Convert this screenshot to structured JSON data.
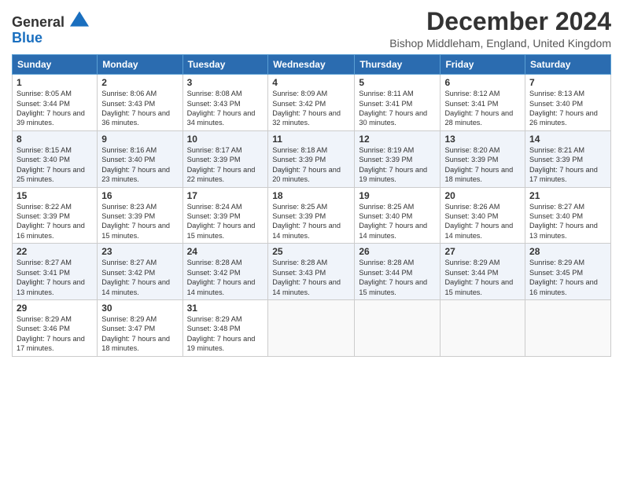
{
  "header": {
    "logo_line1": "General",
    "logo_line2": "Blue",
    "month_title": "December 2024",
    "subtitle": "Bishop Middleham, England, United Kingdom"
  },
  "days_of_week": [
    "Sunday",
    "Monday",
    "Tuesday",
    "Wednesday",
    "Thursday",
    "Friday",
    "Saturday"
  ],
  "weeks": [
    [
      {
        "day": "1",
        "sunrise": "Sunrise: 8:05 AM",
        "sunset": "Sunset: 3:44 PM",
        "daylight": "Daylight: 7 hours and 39 minutes."
      },
      {
        "day": "2",
        "sunrise": "Sunrise: 8:06 AM",
        "sunset": "Sunset: 3:43 PM",
        "daylight": "Daylight: 7 hours and 36 minutes."
      },
      {
        "day": "3",
        "sunrise": "Sunrise: 8:08 AM",
        "sunset": "Sunset: 3:43 PM",
        "daylight": "Daylight: 7 hours and 34 minutes."
      },
      {
        "day": "4",
        "sunrise": "Sunrise: 8:09 AM",
        "sunset": "Sunset: 3:42 PM",
        "daylight": "Daylight: 7 hours and 32 minutes."
      },
      {
        "day": "5",
        "sunrise": "Sunrise: 8:11 AM",
        "sunset": "Sunset: 3:41 PM",
        "daylight": "Daylight: 7 hours and 30 minutes."
      },
      {
        "day": "6",
        "sunrise": "Sunrise: 8:12 AM",
        "sunset": "Sunset: 3:41 PM",
        "daylight": "Daylight: 7 hours and 28 minutes."
      },
      {
        "day": "7",
        "sunrise": "Sunrise: 8:13 AM",
        "sunset": "Sunset: 3:40 PM",
        "daylight": "Daylight: 7 hours and 26 minutes."
      }
    ],
    [
      {
        "day": "8",
        "sunrise": "Sunrise: 8:15 AM",
        "sunset": "Sunset: 3:40 PM",
        "daylight": "Daylight: 7 hours and 25 minutes."
      },
      {
        "day": "9",
        "sunrise": "Sunrise: 8:16 AM",
        "sunset": "Sunset: 3:40 PM",
        "daylight": "Daylight: 7 hours and 23 minutes."
      },
      {
        "day": "10",
        "sunrise": "Sunrise: 8:17 AM",
        "sunset": "Sunset: 3:39 PM",
        "daylight": "Daylight: 7 hours and 22 minutes."
      },
      {
        "day": "11",
        "sunrise": "Sunrise: 8:18 AM",
        "sunset": "Sunset: 3:39 PM",
        "daylight": "Daylight: 7 hours and 20 minutes."
      },
      {
        "day": "12",
        "sunrise": "Sunrise: 8:19 AM",
        "sunset": "Sunset: 3:39 PM",
        "daylight": "Daylight: 7 hours and 19 minutes."
      },
      {
        "day": "13",
        "sunrise": "Sunrise: 8:20 AM",
        "sunset": "Sunset: 3:39 PM",
        "daylight": "Daylight: 7 hours and 18 minutes."
      },
      {
        "day": "14",
        "sunrise": "Sunrise: 8:21 AM",
        "sunset": "Sunset: 3:39 PM",
        "daylight": "Daylight: 7 hours and 17 minutes."
      }
    ],
    [
      {
        "day": "15",
        "sunrise": "Sunrise: 8:22 AM",
        "sunset": "Sunset: 3:39 PM",
        "daylight": "Daylight: 7 hours and 16 minutes."
      },
      {
        "day": "16",
        "sunrise": "Sunrise: 8:23 AM",
        "sunset": "Sunset: 3:39 PM",
        "daylight": "Daylight: 7 hours and 15 minutes."
      },
      {
        "day": "17",
        "sunrise": "Sunrise: 8:24 AM",
        "sunset": "Sunset: 3:39 PM",
        "daylight": "Daylight: 7 hours and 15 minutes."
      },
      {
        "day": "18",
        "sunrise": "Sunrise: 8:25 AM",
        "sunset": "Sunset: 3:39 PM",
        "daylight": "Daylight: 7 hours and 14 minutes."
      },
      {
        "day": "19",
        "sunrise": "Sunrise: 8:25 AM",
        "sunset": "Sunset: 3:40 PM",
        "daylight": "Daylight: 7 hours and 14 minutes."
      },
      {
        "day": "20",
        "sunrise": "Sunrise: 8:26 AM",
        "sunset": "Sunset: 3:40 PM",
        "daylight": "Daylight: 7 hours and 14 minutes."
      },
      {
        "day": "21",
        "sunrise": "Sunrise: 8:27 AM",
        "sunset": "Sunset: 3:40 PM",
        "daylight": "Daylight: 7 hours and 13 minutes."
      }
    ],
    [
      {
        "day": "22",
        "sunrise": "Sunrise: 8:27 AM",
        "sunset": "Sunset: 3:41 PM",
        "daylight": "Daylight: 7 hours and 13 minutes."
      },
      {
        "day": "23",
        "sunrise": "Sunrise: 8:27 AM",
        "sunset": "Sunset: 3:42 PM",
        "daylight": "Daylight: 7 hours and 14 minutes."
      },
      {
        "day": "24",
        "sunrise": "Sunrise: 8:28 AM",
        "sunset": "Sunset: 3:42 PM",
        "daylight": "Daylight: 7 hours and 14 minutes."
      },
      {
        "day": "25",
        "sunrise": "Sunrise: 8:28 AM",
        "sunset": "Sunset: 3:43 PM",
        "daylight": "Daylight: 7 hours and 14 minutes."
      },
      {
        "day": "26",
        "sunrise": "Sunrise: 8:28 AM",
        "sunset": "Sunset: 3:44 PM",
        "daylight": "Daylight: 7 hours and 15 minutes."
      },
      {
        "day": "27",
        "sunrise": "Sunrise: 8:29 AM",
        "sunset": "Sunset: 3:44 PM",
        "daylight": "Daylight: 7 hours and 15 minutes."
      },
      {
        "day": "28",
        "sunrise": "Sunrise: 8:29 AM",
        "sunset": "Sunset: 3:45 PM",
        "daylight": "Daylight: 7 hours and 16 minutes."
      }
    ],
    [
      {
        "day": "29",
        "sunrise": "Sunrise: 8:29 AM",
        "sunset": "Sunset: 3:46 PM",
        "daylight": "Daylight: 7 hours and 17 minutes."
      },
      {
        "day": "30",
        "sunrise": "Sunrise: 8:29 AM",
        "sunset": "Sunset: 3:47 PM",
        "daylight": "Daylight: 7 hours and 18 minutes."
      },
      {
        "day": "31",
        "sunrise": "Sunrise: 8:29 AM",
        "sunset": "Sunset: 3:48 PM",
        "daylight": "Daylight: 7 hours and 19 minutes."
      },
      null,
      null,
      null,
      null
    ]
  ]
}
